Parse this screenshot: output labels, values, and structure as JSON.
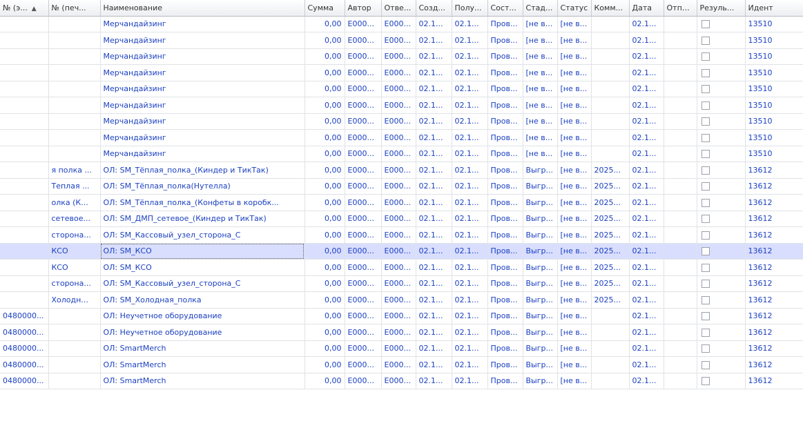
{
  "table": {
    "sort_column": 0,
    "sort_icon": "sort-ascending-icon",
    "columns": [
      {
        "key": "num_e",
        "label": "№ (э..."
      },
      {
        "key": "num_print",
        "label": "№ (печ..."
      },
      {
        "key": "name",
        "label": "Наименование"
      },
      {
        "key": "sum",
        "label": "Сумма"
      },
      {
        "key": "author",
        "label": "Автор"
      },
      {
        "key": "resp",
        "label": "Отве..."
      },
      {
        "key": "created",
        "label": "Созд..."
      },
      {
        "key": "received",
        "label": "Полу..."
      },
      {
        "key": "state",
        "label": "Сост..."
      },
      {
        "key": "stage",
        "label": "Стад..."
      },
      {
        "key": "status",
        "label": "Статус"
      },
      {
        "key": "comment",
        "label": "Комм..."
      },
      {
        "key": "date",
        "label": "Дата"
      },
      {
        "key": "sent",
        "label": "Отпр..."
      },
      {
        "key": "result",
        "label": "Резуль..."
      },
      {
        "key": "ident",
        "label": "Идент"
      }
    ],
    "selected_row": 14,
    "rows": [
      {
        "num_e": "",
        "num_print": "",
        "name": "Мерчандайзинг",
        "sum": "0,00",
        "author": "E000...",
        "resp": "E000...",
        "created": "02.1...",
        "received": "02.1...",
        "state": "Пров...",
        "stage": "[не в...",
        "status": "[не в...",
        "comment": "",
        "date": "02.1...",
        "sent": "",
        "result": false,
        "ident": "13510"
      },
      {
        "num_e": "",
        "num_print": "",
        "name": "Мерчандайзинг",
        "sum": "0,00",
        "author": "E000...",
        "resp": "E000...",
        "created": "02.1...",
        "received": "02.1...",
        "state": "Пров...",
        "stage": "[не в...",
        "status": "[не в...",
        "comment": "",
        "date": "02.1...",
        "sent": "",
        "result": false,
        "ident": "13510"
      },
      {
        "num_e": "",
        "num_print": "",
        "name": "Мерчандайзинг",
        "sum": "0,00",
        "author": "E000...",
        "resp": "E000...",
        "created": "02.1...",
        "received": "02.1...",
        "state": "Пров...",
        "stage": "[не в...",
        "status": "[не в...",
        "comment": "",
        "date": "02.1...",
        "sent": "",
        "result": false,
        "ident": "13510"
      },
      {
        "num_e": "",
        "num_print": "",
        "name": "Мерчандайзинг",
        "sum": "0,00",
        "author": "E000...",
        "resp": "E000...",
        "created": "02.1...",
        "received": "02.1...",
        "state": "Пров...",
        "stage": "[не в...",
        "status": "[не в...",
        "comment": "",
        "date": "02.1...",
        "sent": "",
        "result": false,
        "ident": "13510"
      },
      {
        "num_e": "",
        "num_print": "",
        "name": "Мерчандайзинг",
        "sum": "0,00",
        "author": "E000...",
        "resp": "E000...",
        "created": "02.1...",
        "received": "02.1...",
        "state": "Пров...",
        "stage": "[не в...",
        "status": "[не в...",
        "comment": "",
        "date": "02.1...",
        "sent": "",
        "result": false,
        "ident": "13510"
      },
      {
        "num_e": "",
        "num_print": "",
        "name": "Мерчандайзинг",
        "sum": "0,00",
        "author": "E000...",
        "resp": "E000...",
        "created": "02.1...",
        "received": "02.1...",
        "state": "Пров...",
        "stage": "[не в...",
        "status": "[не в...",
        "comment": "",
        "date": "02.1...",
        "sent": "",
        "result": false,
        "ident": "13510"
      },
      {
        "num_e": "",
        "num_print": "",
        "name": "Мерчандайзинг",
        "sum": "0,00",
        "author": "E000...",
        "resp": "E000...",
        "created": "02.1...",
        "received": "02.1...",
        "state": "Пров...",
        "stage": "[не в...",
        "status": "[не в...",
        "comment": "",
        "date": "02.1...",
        "sent": "",
        "result": false,
        "ident": "13510"
      },
      {
        "num_e": "",
        "num_print": "",
        "name": "Мерчандайзинг",
        "sum": "0,00",
        "author": "E000...",
        "resp": "E000...",
        "created": "02.1...",
        "received": "02.1...",
        "state": "Пров...",
        "stage": "[не в...",
        "status": "[не в...",
        "comment": "",
        "date": "02.1...",
        "sent": "",
        "result": false,
        "ident": "13510"
      },
      {
        "num_e": "",
        "num_print": "",
        "name": "Мерчандайзинг",
        "sum": "0,00",
        "author": "E000...",
        "resp": "E000...",
        "created": "02.1...",
        "received": "02.1...",
        "state": "Пров...",
        "stage": "[не в...",
        "status": "[не в...",
        "comment": "",
        "date": "02.1...",
        "sent": "",
        "result": false,
        "ident": "13510"
      },
      {
        "num_e": "",
        "num_print": "я полка ...",
        "name": "ОЛ: SM_Тёплая_полка_(Киндер и ТикТак)",
        "sum": "0,00",
        "author": "E000...",
        "resp": "E000...",
        "created": "02.1...",
        "received": "02.1...",
        "state": "Пров...",
        "stage": "Выгр...",
        "status": "[не в...",
        "comment": "2025...",
        "date": "02.1...",
        "sent": "",
        "result": false,
        "ident": "13612"
      },
      {
        "num_e": "",
        "num_print": "Теплая ...",
        "name": "ОЛ: SM_Тёплая_полка(Нутелла)",
        "sum": "0,00",
        "author": "E000...",
        "resp": "E000...",
        "created": "02.1...",
        "received": "02.1...",
        "state": "Пров...",
        "stage": "Выгр...",
        "status": "[не в...",
        "comment": "2025...",
        "date": "02.1...",
        "sent": "",
        "result": false,
        "ident": "13612"
      },
      {
        "num_e": "",
        "num_print": "олка (К...",
        "name": "ОЛ: SM_Тёплая_полка_(Конфеты в коробк...",
        "sum": "0,00",
        "author": "E000...",
        "resp": "E000...",
        "created": "02.1...",
        "received": "02.1...",
        "state": "Пров...",
        "stage": "Выгр...",
        "status": "[не в...",
        "comment": "2025...",
        "date": "02.1...",
        "sent": "",
        "result": false,
        "ident": "13612"
      },
      {
        "num_e": "",
        "num_print": "сетевое...",
        "name": "ОЛ: SM_ДМП_сетевое_(Киндер и ТикТак)",
        "sum": "0,00",
        "author": "E000...",
        "resp": "E000...",
        "created": "02.1...",
        "received": "02.1...",
        "state": "Пров...",
        "stage": "Выгр...",
        "status": "[не в...",
        "comment": "2025...",
        "date": "02.1...",
        "sent": "",
        "result": false,
        "ident": "13612"
      },
      {
        "num_e": "",
        "num_print": "сторона...",
        "name": "ОЛ: SM_Кассовый_узел_сторона_С",
        "sum": "0,00",
        "author": "E000...",
        "resp": "E000...",
        "created": "02.1...",
        "received": "02.1...",
        "state": "Пров...",
        "stage": "Выгр...",
        "status": "[не в...",
        "comment": "2025...",
        "date": "02.1...",
        "sent": "",
        "result": false,
        "ident": "13612"
      },
      {
        "num_e": "",
        "num_print": "КСО",
        "name": "ОЛ: SM_КСО",
        "sum": "0,00",
        "author": "E000...",
        "resp": "E000...",
        "created": "02.1...",
        "received": "02.1...",
        "state": "Пров...",
        "stage": "Выгр...",
        "status": "[не в...",
        "comment": "2025...",
        "date": "02.1...",
        "sent": "",
        "result": false,
        "ident": "13612"
      },
      {
        "num_e": "",
        "num_print": "КСО",
        "name": "ОЛ: SM_КСО",
        "sum": "0,00",
        "author": "E000...",
        "resp": "E000...",
        "created": "02.1...",
        "received": "02.1...",
        "state": "Пров...",
        "stage": "Выгр...",
        "status": "[не в...",
        "comment": "2025...",
        "date": "02.1...",
        "sent": "",
        "result": false,
        "ident": "13612"
      },
      {
        "num_e": "",
        "num_print": "сторона...",
        "name": "ОЛ: SM_Кассовый_узел_сторона_С",
        "sum": "0,00",
        "author": "E000...",
        "resp": "E000...",
        "created": "02.1...",
        "received": "02.1...",
        "state": "Пров...",
        "stage": "Выгр...",
        "status": "[не в...",
        "comment": "2025...",
        "date": "02.1...",
        "sent": "",
        "result": false,
        "ident": "13612"
      },
      {
        "num_e": "",
        "num_print": "Холодн...",
        "name": "ОЛ: SM_Холодная_полка",
        "sum": "0,00",
        "author": "E000...",
        "resp": "E000...",
        "created": "02.1...",
        "received": "02.1...",
        "state": "Пров...",
        "stage": "Выгр...",
        "status": "[не в...",
        "comment": "2025...",
        "date": "02.1...",
        "sent": "",
        "result": false,
        "ident": "13612"
      },
      {
        "num_e": "0480000...",
        "num_print": "",
        "name": "ОЛ: Неучетное оборудование",
        "sum": "0,00",
        "author": "E000...",
        "resp": "E000...",
        "created": "02.1...",
        "received": "02.1...",
        "state": "Пров...",
        "stage": "Выгр...",
        "status": "[не в...",
        "comment": "",
        "date": "02.1...",
        "sent": "",
        "result": false,
        "ident": "13612"
      },
      {
        "num_e": "0480000...",
        "num_print": "",
        "name": "ОЛ: Неучетное оборудование",
        "sum": "0,00",
        "author": "E000...",
        "resp": "E000...",
        "created": "02.1...",
        "received": "02.1...",
        "state": "Пров...",
        "stage": "Выгр...",
        "status": "[не в...",
        "comment": "",
        "date": "02.1...",
        "sent": "",
        "result": false,
        "ident": "13612"
      },
      {
        "num_e": "0480000...",
        "num_print": "",
        "name": "ОЛ: SmartMerch",
        "sum": "0,00",
        "author": "E000...",
        "resp": "E000...",
        "created": "02.1...",
        "received": "02.1...",
        "state": "Пров...",
        "stage": "Выгр...",
        "status": "[не в...",
        "comment": "",
        "date": "02.1...",
        "sent": "",
        "result": false,
        "ident": "13612"
      },
      {
        "num_e": "0480000...",
        "num_print": "",
        "name": "ОЛ: SmartMerch",
        "sum": "0,00",
        "author": "E000...",
        "resp": "E000...",
        "created": "02.1...",
        "received": "02.1...",
        "state": "Пров...",
        "stage": "Выгр...",
        "status": "[не в...",
        "comment": "",
        "date": "02.1...",
        "sent": "",
        "result": false,
        "ident": "13612"
      },
      {
        "num_e": "0480000...",
        "num_print": "",
        "name": "ОЛ: SmartMerch",
        "sum": "0,00",
        "author": "E000...",
        "resp": "E000...",
        "created": "02.1...",
        "received": "02.1...",
        "state": "Пров...",
        "stage": "Выгр...",
        "status": "[не в...",
        "comment": "",
        "date": "02.1...",
        "sent": "",
        "result": false,
        "ident": "13612"
      }
    ]
  }
}
